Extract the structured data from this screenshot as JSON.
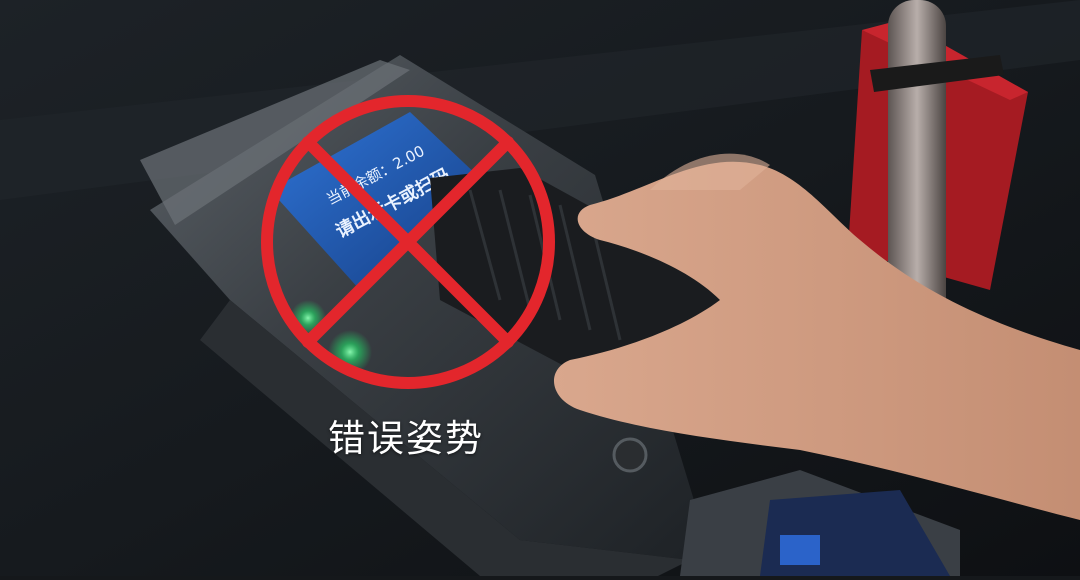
{
  "caption": "错误姿势",
  "screen": {
    "line1": "当前余额：2.00",
    "line2": "请出示卡或扫码"
  },
  "icons": {
    "prohibition": "prohibition-icon"
  },
  "colors": {
    "prohibition_red": "#e3262c",
    "indicator_green": "#22e06a",
    "screen_blue": "#1e5aa8"
  }
}
